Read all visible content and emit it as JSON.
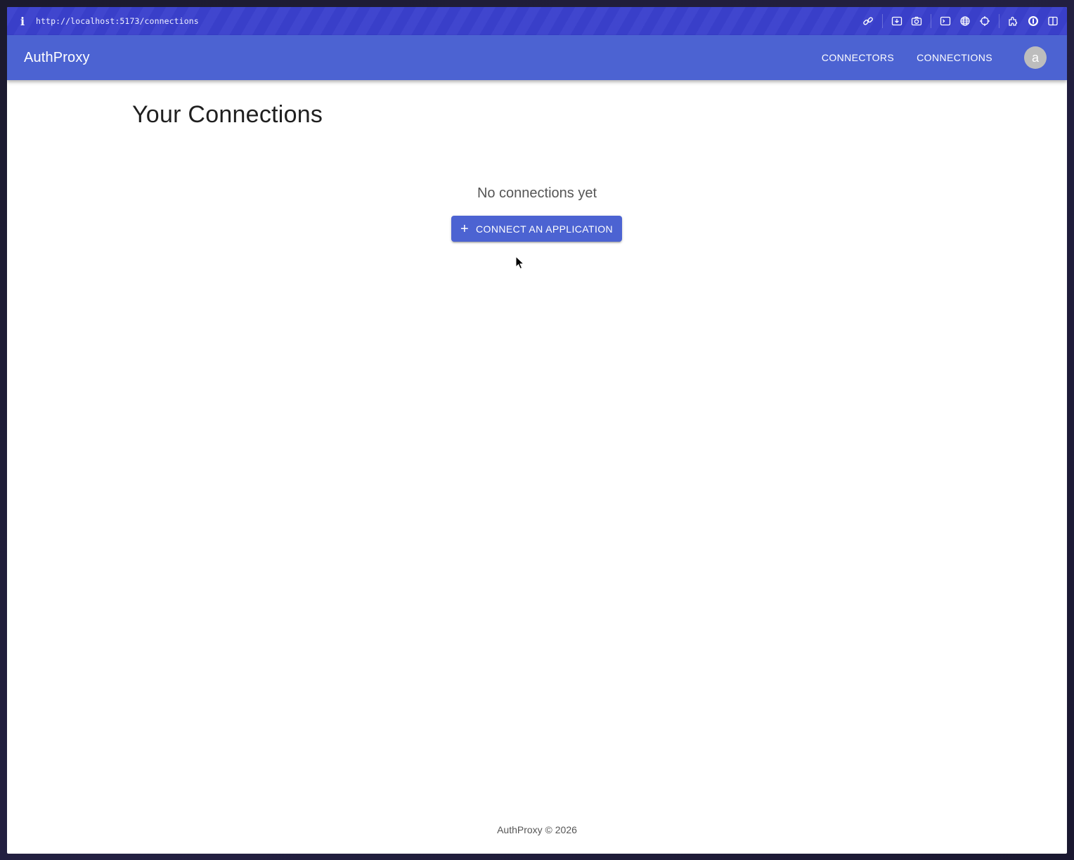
{
  "browser": {
    "url": "http://localhost:5173/connections",
    "info_icon": "i",
    "toolbar_icons": [
      "link-icon",
      "download-icon",
      "camera-icon",
      "terminal-icon",
      "globe-icon",
      "crosshair-icon",
      "extension-icon",
      "password-manager-icon",
      "sidebar-icon"
    ]
  },
  "appbar": {
    "brand": "AuthProxy",
    "nav": [
      {
        "label": "CONNECTORS"
      },
      {
        "label": "CONNECTIONS"
      }
    ],
    "avatar_initial": "a"
  },
  "main": {
    "title": "Your Connections",
    "empty_message": "No connections yet",
    "cta_icon": "+",
    "cta_label": "CONNECT AN APPLICATION"
  },
  "footer": {
    "text": "AuthProxy © 2026"
  },
  "colors": {
    "browser_bar": "#3a40cd",
    "appbar": "#4c63d2",
    "primary": "#4c63d2"
  }
}
